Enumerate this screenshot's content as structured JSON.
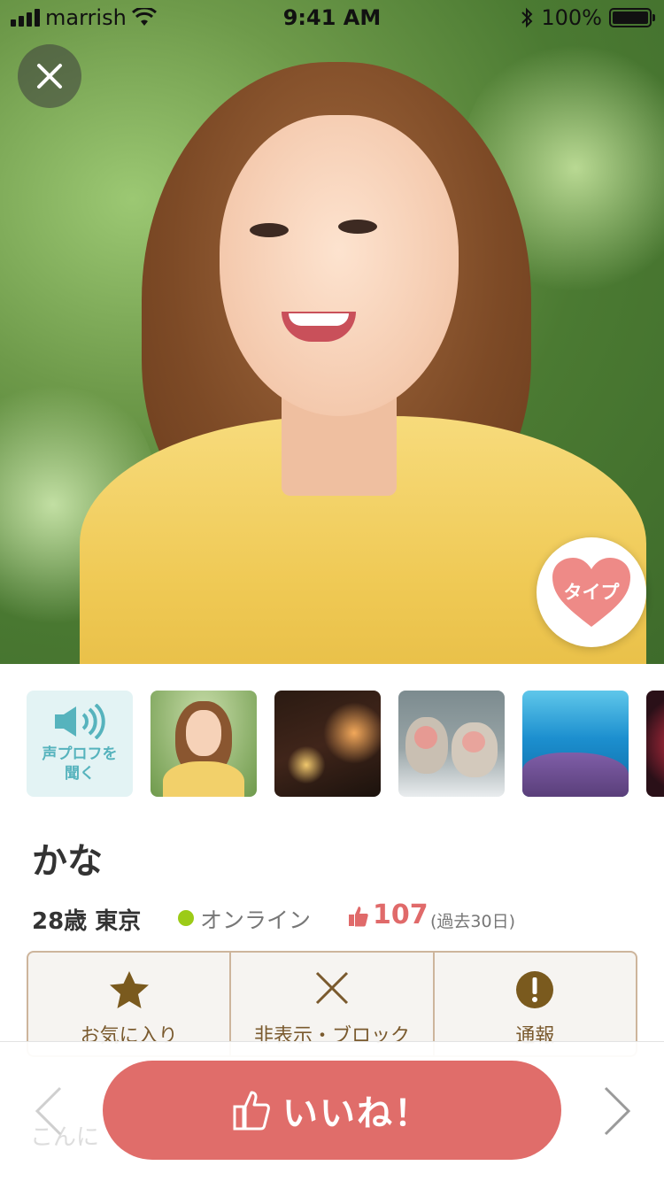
{
  "status_bar": {
    "carrier": "marrish",
    "time": "9:41 AM",
    "battery": "100%"
  },
  "profile": {
    "type_button_label": "タイプ",
    "voice_profile_label": "声プロフを聞く",
    "name": "かな",
    "age_location": "28歳 東京",
    "online_status": "オンライン",
    "likes_count": "107",
    "likes_period": "(過去30日)"
  },
  "actions": {
    "favorite": "お気に入り",
    "hide_block": "非表示・ブロック",
    "report": "通報"
  },
  "bottom": {
    "like_button": "いいね！",
    "message_preview": "こんに"
  },
  "icons": {
    "close": "close-icon",
    "heart": "heart-icon",
    "speaker": "speaker-icon",
    "star": "star-icon",
    "x": "x-icon",
    "exclamation": "exclamation-icon",
    "thumbs_up": "thumbs-up-icon",
    "chevron_left": "chevron-left-icon",
    "chevron_right": "chevron-right-icon"
  },
  "colors": {
    "accent": "#e06d6a",
    "voice_teal": "#56b3bd",
    "action_brown": "#7a5a2e",
    "online_green": "#9ccb17"
  }
}
